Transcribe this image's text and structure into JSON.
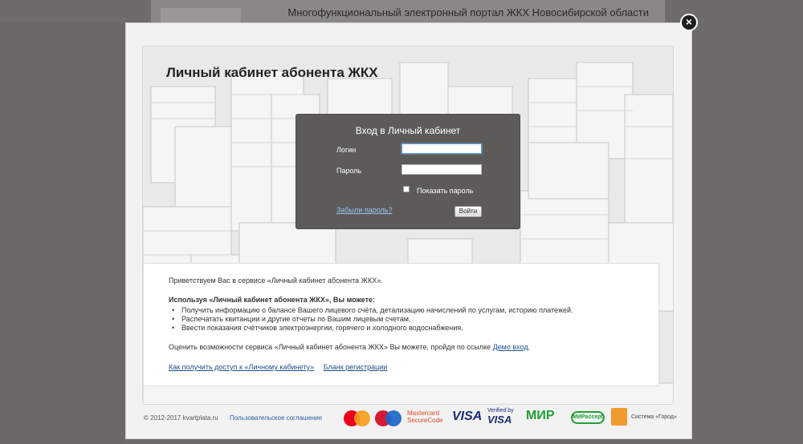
{
  "background": {
    "portal_title": "Многофункциональный электронный портал ЖКХ Новосибирской области"
  },
  "modal": {
    "close_icon": "close-icon",
    "page_title": "Личный кабинет абонента ЖКХ",
    "login": {
      "title": "Вход в Личный кабинет",
      "login_label": "Логин",
      "login_value": "",
      "password_label": "Пароль",
      "password_value": "",
      "show_password_label": "Показать пароль",
      "forgot_label": "Забыли пароль?",
      "enter_label": "Войти"
    },
    "info": {
      "greeting": "Приветствуем Вас в сервисе «Личный кабинет абонента ЖКХ».",
      "subhead": "Используя «Личный кабинет абонента ЖКХ», Вы можете:",
      "items": [
        "Получить информацию о балансе Вашего лицевого счёта, детализацию начислений по услугам, историю платежей.",
        "Распечатать квитанции и другие отчеты по Вашим лицевым счетам.",
        "Ввести показания счётчиков электроэнергии, горячего и холодного водоснабжения."
      ],
      "demo_text": "Оценить возможности сервиса «Личный кабинет абонента ЖКХ» Вы можете, пройдя по ссылке",
      "demo_link": "Демо вход",
      "demo_end": ".",
      "access_link": "Как получить доступ к «Личному кабинету»",
      "registration_link": "Бланк регистрации"
    },
    "footer": {
      "copyright": "© 2012-2017 kvartplata.ru",
      "agreement": "Пользовательское соглашение",
      "mastercard_securecode": [
        "Mastercard",
        "SecureCode"
      ],
      "visa": "VISA",
      "verified_by": "Verified by",
      "verified_visa": "VISA",
      "mir": "МИР",
      "mir_accept": "МИРaccept",
      "gorod": "Система «Город»"
    }
  }
}
